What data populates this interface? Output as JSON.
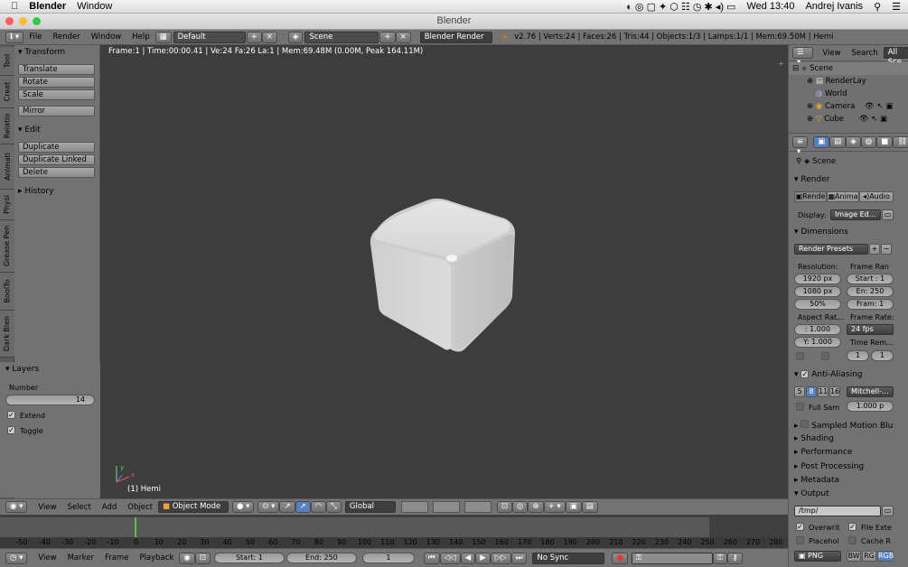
{
  "macbar": {
    "app": "Blender",
    "menu_window": "Window",
    "clock": "Wed 13:40",
    "user": "Andrej Ivanis"
  },
  "window": {
    "title": "Blender"
  },
  "info": {
    "menus": [
      "File",
      "Render",
      "Window",
      "Help"
    ],
    "layout": "Default",
    "scene": "Scene",
    "engine": "Blender Render",
    "stats": "v2.76 | Verts:24 | Faces:26 | Tris:44 | Objects:1/3 | Lamps:1/1 | Mem:69.50M | Hemi"
  },
  "viewport": {
    "status": "Frame:1 | Time:00:00.41 | Ve:24 Fa:26 La:1 | Mem:69.48M (0.00M, Peak 164.11M)",
    "object_label": "(1) Hemi",
    "axis_y": "y",
    "axis_x": "x"
  },
  "tabs": [
    "Tool",
    "Creat",
    "Relatio",
    "Animati",
    "Physi",
    "Grease Pen",
    "BoolTo",
    "Dark Blen"
  ],
  "toolshelf": {
    "transform": {
      "title": "Transform",
      "buttons": [
        "Translate",
        "Rotate",
        "Scale"
      ],
      "mirror": "Mirror"
    },
    "edit": {
      "title": "Edit",
      "buttons": [
        "Duplicate",
        "Duplicate Linked",
        "Delete"
      ]
    },
    "history": "History",
    "layers": {
      "title": "Layers",
      "number_label": "Number",
      "number": "14",
      "extend": "Extend",
      "toggle": "Toggle"
    }
  },
  "v3dheader": {
    "menus": [
      "View",
      "Select",
      "Add",
      "Object"
    ],
    "mode": "Object Mode",
    "orientation": "Global"
  },
  "timeline": {
    "ticks": [
      "-50",
      "-40",
      "-30",
      "-20",
      "-10",
      "0",
      "10",
      "20",
      "30",
      "40",
      "50",
      "60",
      "70",
      "80",
      "90",
      "100",
      "110",
      "120",
      "130",
      "140",
      "150",
      "160",
      "170",
      "180",
      "190",
      "200",
      "210",
      "220",
      "230",
      "240",
      "250",
      "260",
      "270",
      "280"
    ]
  },
  "tlheader": {
    "menus": [
      "View",
      "Marker",
      "Frame",
      "Playback"
    ],
    "start_label": "Start:",
    "start": "1",
    "end_label": "End:",
    "end": "250",
    "current": "1",
    "sync": "No Sync"
  },
  "outliner": {
    "menus": [
      "View",
      "Search",
      "All Sce"
    ],
    "items": [
      "Scene",
      "RenderLay",
      "World",
      "Camera",
      "Cube"
    ]
  },
  "props": {
    "scene": "Scene",
    "render": {
      "title": "Render",
      "tabs": [
        "Rende",
        "Anima",
        "Audio"
      ],
      "display_label": "Display:",
      "display": "Image Ed..."
    },
    "dimensions": {
      "title": "Dimensions",
      "presets": "Render Presets",
      "resolution": "Resolution:",
      "res_x": "1920 px",
      "res_y": "1080 px",
      "res_pct": "50%",
      "frame_range": "Frame Ran",
      "start": "Start : 1",
      "end": "En: 250",
      "frame": "Fram: 1",
      "aspect": "Aspect Rat...",
      "aspect_x": ":  1.000",
      "aspect_y": "Y: 1.000",
      "frame_rate": "Frame Rate:",
      "fps": "24 fps",
      "time_rem": "Time Rem...",
      "rem_a": "1",
      "rem_b": "1"
    },
    "aa": {
      "title": "Anti-Aliasing",
      "samples": [
        "5",
        "8",
        "11",
        "16"
      ],
      "filter": "Mitchell-...",
      "full_sample": "Full Sam",
      "size": "1.000 p"
    },
    "collapsed": [
      "Sampled Motion Blu",
      "Shading",
      "Performance",
      "Post Processing",
      "Metadata"
    ],
    "output": {
      "title": "Output",
      "path": "/tmp/",
      "overwrite": "Overwrit",
      "file_ext": "File Exte",
      "placeholders": "Placehol",
      "cache": "Cache R",
      "format": "PNG",
      "bw": "BW",
      "rgb": "RG",
      "rgba": "RGB"
    }
  }
}
